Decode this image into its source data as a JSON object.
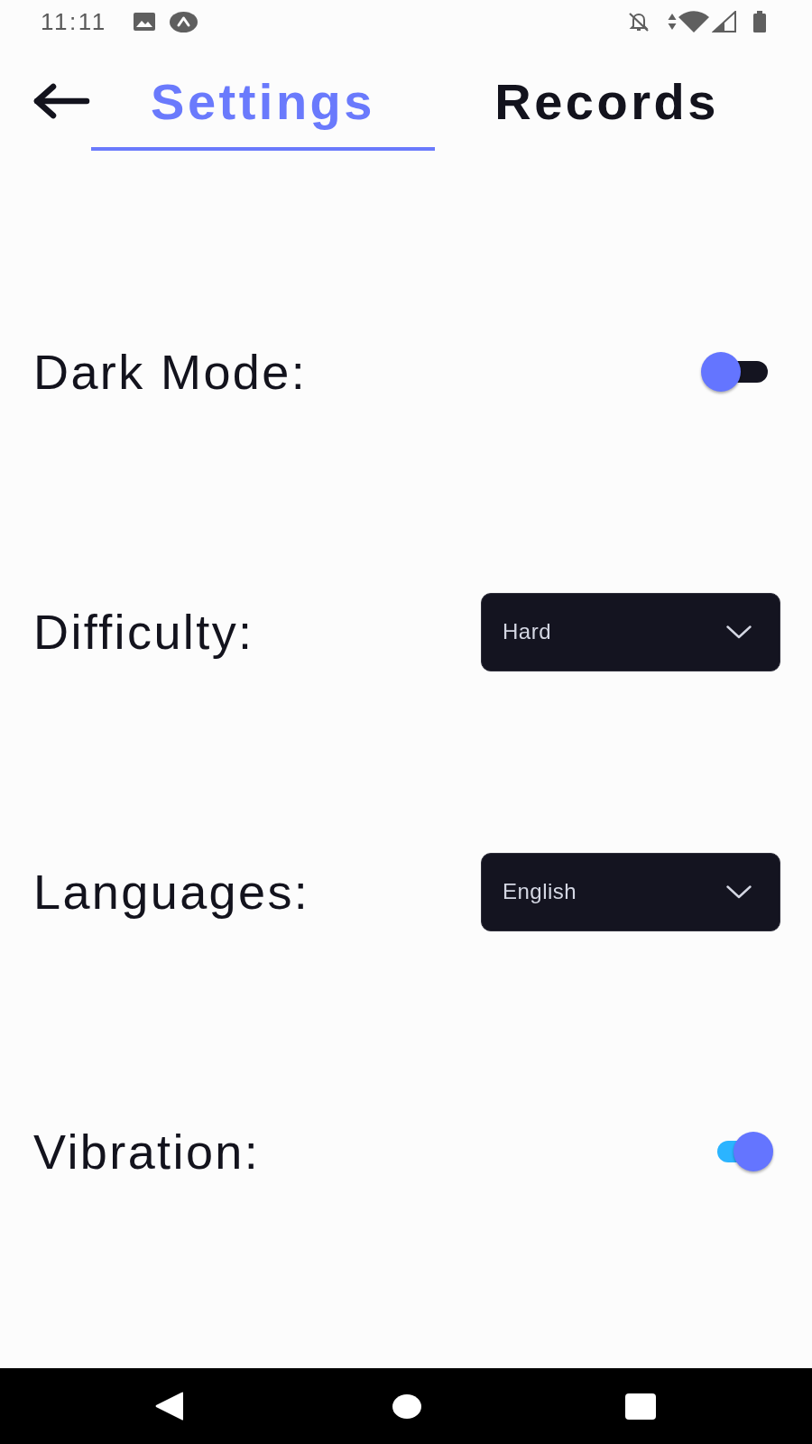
{
  "status_bar": {
    "time": "11:11"
  },
  "header": {
    "tabs": [
      {
        "label": "Settings",
        "selected": true
      },
      {
        "label": "Records",
        "selected": false
      }
    ]
  },
  "settings": [
    {
      "kind": "switch",
      "label": "Dark Mode:",
      "on": false
    },
    {
      "kind": "select",
      "label": "Difficulty:",
      "value": "Hard"
    },
    {
      "kind": "select",
      "label": "Languages:",
      "value": "English"
    },
    {
      "kind": "switch",
      "label": "Vibration:",
      "on": true
    }
  ]
}
